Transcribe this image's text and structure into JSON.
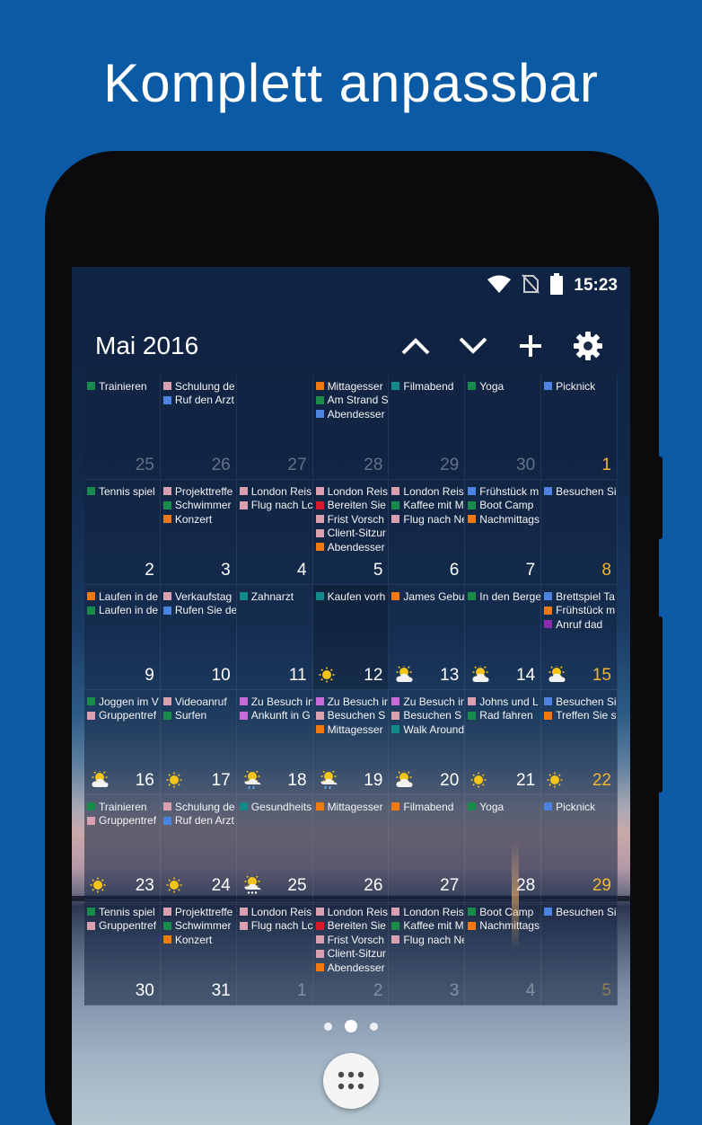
{
  "headline": "Komplett anpassbar",
  "status_bar": {
    "time": "15:23",
    "icons": [
      "wifi-icon",
      "no-sim-icon",
      "battery-icon"
    ]
  },
  "widget": {
    "title": "Mai 2016",
    "buttons": [
      "chevron-up-icon",
      "chevron-down-icon",
      "plus-icon",
      "gear-icon"
    ]
  },
  "colors": {
    "green": "#1a8a4a",
    "pink": "#d9a0b0",
    "blue": "#4a84e0",
    "orange": "#f07a10",
    "teal": "#138a8a",
    "red": "#d81b2a",
    "purple": "#8a2ab0",
    "violet": "#c86ad8",
    "weekend": "#f2b632"
  },
  "weeks": [
    [
      {
        "day": "25",
        "outside": true,
        "events": [
          [
            "green",
            "Trainieren"
          ]
        ]
      },
      {
        "day": "26",
        "outside": true,
        "events": [
          [
            "pink",
            "Schulung de"
          ],
          [
            "blue",
            "Ruf den Arzt"
          ]
        ]
      },
      {
        "day": "27",
        "outside": true,
        "events": []
      },
      {
        "day": "28",
        "outside": true,
        "events": [
          [
            "orange",
            "Mittagesser"
          ],
          [
            "green",
            "Am Strand S"
          ],
          [
            "blue",
            "Abendesser"
          ]
        ]
      },
      {
        "day": "29",
        "outside": true,
        "events": [
          [
            "teal",
            "Filmabend"
          ]
        ]
      },
      {
        "day": "30",
        "outside": true,
        "events": [
          [
            "green",
            "Yoga"
          ]
        ]
      },
      {
        "day": "1",
        "weekend": true,
        "events": [
          [
            "blue",
            "Picknick"
          ]
        ]
      }
    ],
    [
      {
        "day": "2",
        "events": [
          [
            "green",
            "Tennis spiel"
          ]
        ]
      },
      {
        "day": "3",
        "events": [
          [
            "pink",
            "Projekttreffe"
          ],
          [
            "green",
            "Schwimmer"
          ],
          [
            "orange",
            "Konzert"
          ]
        ]
      },
      {
        "day": "4",
        "events": [
          [
            "pink",
            "London Reis"
          ],
          [
            "pink",
            "Flug nach Lc"
          ]
        ]
      },
      {
        "day": "5",
        "events": [
          [
            "pink",
            "London Reis"
          ],
          [
            "red",
            "Bereiten Sie"
          ],
          [
            "pink",
            "Frist Vorsch"
          ],
          [
            "pink",
            "Client-Sitzur"
          ],
          [
            "orange",
            "Abendesser"
          ]
        ]
      },
      {
        "day": "6",
        "events": [
          [
            "pink",
            "London Reis"
          ],
          [
            "green",
            "Kaffee mit M"
          ],
          [
            "pink",
            "Flug nach Ne"
          ]
        ]
      },
      {
        "day": "7",
        "events": [
          [
            "blue",
            "Frühstück m"
          ],
          [
            "green",
            "Boot Camp"
          ],
          [
            "orange",
            "Nachmittags"
          ]
        ]
      },
      {
        "day": "8",
        "weekend": true,
        "events": [
          [
            "blue",
            "Besuchen Si"
          ]
        ]
      }
    ],
    [
      {
        "day": "9",
        "events": [
          [
            "orange",
            "Laufen in de"
          ],
          [
            "green",
            "Laufen in de"
          ]
        ]
      },
      {
        "day": "10",
        "events": [
          [
            "pink",
            "Verkaufstag"
          ],
          [
            "blue",
            "Rufen Sie de"
          ]
        ]
      },
      {
        "day": "11",
        "events": [
          [
            "teal",
            "Zahnarzt"
          ]
        ]
      },
      {
        "day": "12",
        "today": true,
        "weather": "sun",
        "events": [
          [
            "teal",
            "Kaufen vorh"
          ]
        ]
      },
      {
        "day": "13",
        "weather": "partly",
        "events": [
          [
            "orange",
            "James Gebu"
          ]
        ]
      },
      {
        "day": "14",
        "weather": "partly",
        "events": [
          [
            "green",
            "In den Berge"
          ]
        ]
      },
      {
        "day": "15",
        "weekend": true,
        "weather": "partly",
        "events": [
          [
            "blue",
            "Brettspiel Ta"
          ],
          [
            "orange",
            "Frühstück m"
          ],
          [
            "purple",
            "Anruf dad"
          ]
        ]
      }
    ],
    [
      {
        "day": "16",
        "weather": "partly",
        "events": [
          [
            "green",
            "Joggen im V"
          ],
          [
            "pink",
            "Gruppentref"
          ]
        ]
      },
      {
        "day": "17",
        "weather": "sun",
        "events": [
          [
            "pink",
            "Videoanruf"
          ],
          [
            "green",
            "Surfen"
          ]
        ]
      },
      {
        "day": "18",
        "weather": "rain",
        "events": [
          [
            "violet",
            "Zu Besuch in"
          ],
          [
            "violet",
            "Ankunft in G"
          ]
        ]
      },
      {
        "day": "19",
        "weather": "rain",
        "events": [
          [
            "violet",
            "Zu Besuch in"
          ],
          [
            "pink",
            "Besuchen S"
          ],
          [
            "orange",
            "Mittagesser"
          ]
        ]
      },
      {
        "day": "20",
        "weather": "partly",
        "events": [
          [
            "violet",
            "Zu Besuch in"
          ],
          [
            "pink",
            "Besuchen S"
          ],
          [
            "teal",
            "Walk Around"
          ]
        ]
      },
      {
        "day": "21",
        "weather": "sun",
        "events": [
          [
            "pink",
            "Johns und L"
          ],
          [
            "green",
            "Rad fahren"
          ]
        ]
      },
      {
        "day": "22",
        "weekend": true,
        "weather": "sun",
        "events": [
          [
            "blue",
            "Besuchen Si"
          ],
          [
            "orange",
            "Treffen Sie s"
          ]
        ]
      }
    ],
    [
      {
        "day": "23",
        "weather": "sun",
        "events": [
          [
            "green",
            "Trainieren"
          ],
          [
            "pink",
            "Gruppentref"
          ]
        ]
      },
      {
        "day": "24",
        "weather": "sun",
        "events": [
          [
            "pink",
            "Schulung de"
          ],
          [
            "blue",
            "Ruf den Arzt"
          ]
        ]
      },
      {
        "day": "25",
        "weather": "snow",
        "events": [
          [
            "teal",
            "Gesundheits"
          ]
        ]
      },
      {
        "day": "26",
        "events": [
          [
            "orange",
            "Mittagesser"
          ]
        ]
      },
      {
        "day": "27",
        "events": [
          [
            "orange",
            "Filmabend"
          ]
        ]
      },
      {
        "day": "28",
        "events": [
          [
            "green",
            "Yoga"
          ]
        ]
      },
      {
        "day": "29",
        "weekend": true,
        "events": [
          [
            "blue",
            "Picknick"
          ]
        ]
      }
    ],
    [
      {
        "day": "30",
        "events": [
          [
            "green",
            "Tennis spiel"
          ],
          [
            "pink",
            "Gruppentref"
          ]
        ]
      },
      {
        "day": "31",
        "events": [
          [
            "pink",
            "Projekttreffe"
          ],
          [
            "green",
            "Schwimmer"
          ],
          [
            "orange",
            "Konzert"
          ]
        ]
      },
      {
        "day": "1",
        "outside": true,
        "events": [
          [
            "pink",
            "London Reis"
          ],
          [
            "pink",
            "Flug nach Lc"
          ]
        ]
      },
      {
        "day": "2",
        "outside": true,
        "events": [
          [
            "pink",
            "London Reis"
          ],
          [
            "red",
            "Bereiten Sie"
          ],
          [
            "pink",
            "Frist Vorsch"
          ],
          [
            "pink",
            "Client-Sitzur"
          ],
          [
            "orange",
            "Abendesser"
          ]
        ]
      },
      {
        "day": "3",
        "outside": true,
        "events": [
          [
            "pink",
            "London Reis"
          ],
          [
            "green",
            "Kaffee mit M"
          ],
          [
            "pink",
            "Flug nach Ne"
          ]
        ]
      },
      {
        "day": "4",
        "outside": true,
        "events": [
          [
            "green",
            "Boot Camp"
          ],
          [
            "orange",
            "Nachmittags"
          ]
        ]
      },
      {
        "day": "5",
        "outside": true,
        "weekend": true,
        "events": [
          [
            "blue",
            "Besuchen Si"
          ]
        ]
      }
    ]
  ],
  "pager": {
    "pages": 3,
    "active": 1
  },
  "launcher": "app-drawer-icon"
}
